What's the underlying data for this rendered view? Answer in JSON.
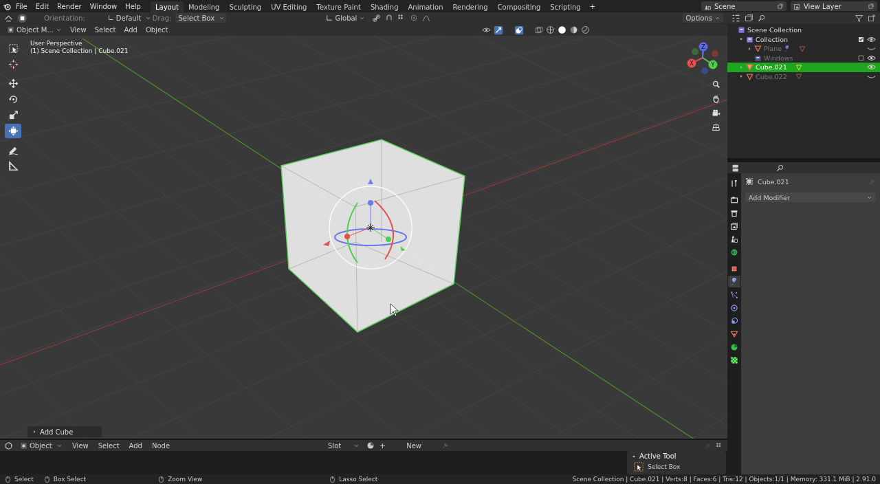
{
  "top_bar": {
    "menus": [
      "File",
      "Edit",
      "Render",
      "Window",
      "Help"
    ],
    "workspaces": [
      {
        "label": "Layout",
        "selected": true
      },
      {
        "label": "Modeling",
        "selected": false
      },
      {
        "label": "Sculpting",
        "selected": false
      },
      {
        "label": "UV Editing",
        "selected": false
      },
      {
        "label": "Texture Paint",
        "selected": false
      },
      {
        "label": "Shading",
        "selected": false
      },
      {
        "label": "Animation",
        "selected": false
      },
      {
        "label": "Rendering",
        "selected": false
      },
      {
        "label": "Compositing",
        "selected": false
      },
      {
        "label": "Scripting",
        "selected": false
      }
    ],
    "add_workspace": "+",
    "scene": "Scene",
    "view_layer": "View Layer"
  },
  "tool_header": {
    "orientation_label": "Orientation:",
    "orientation": "Default",
    "drag_label": "Drag:",
    "drag": "Select Box",
    "transform": "Global",
    "options": "Options"
  },
  "viewport_header": {
    "mode": "Object M...",
    "menus": [
      "View",
      "Select",
      "Add",
      "Object"
    ]
  },
  "viewport": {
    "view_name": "User Perspective",
    "context": "(1) Scene Collection | Cube.021",
    "gizmo_axes": [
      "X",
      "Y",
      "Z"
    ],
    "tools": [
      {
        "kind": "select",
        "selected": false
      },
      {
        "kind": "cursor",
        "selected": false
      },
      {
        "kind": "move",
        "selected": false
      },
      {
        "kind": "rotate",
        "selected": false
      },
      {
        "kind": "scale",
        "selected": false
      },
      {
        "kind": "transform",
        "selected": true
      },
      {
        "kind": "annotate",
        "selected": false
      },
      {
        "kind": "measure",
        "selected": false
      }
    ],
    "last_operation": "Add Cube"
  },
  "bottom_editor": {
    "mode": "Object",
    "menus": [
      "View",
      "Select",
      "Add",
      "Node"
    ],
    "slot": "Slot",
    "new": "New",
    "panel_title": "Active Tool",
    "tool": "Select Box"
  },
  "outliner": {
    "items": [
      {
        "label": "Scene Collection",
        "kind": "scene",
        "selected": false,
        "children": [
          {
            "label": "Collection",
            "kind": "collection",
            "selected": false,
            "expanded": true,
            "included": true,
            "visible": true,
            "children": [
              {
                "label": "Plane",
                "kind": "mesh",
                "selected": false,
                "expanded": false,
                "modifier": true,
                "visible": false
              },
              {
                "label": "Windows",
                "kind": "collection",
                "selected": false,
                "included": false,
                "visible": true
              }
            ]
          },
          {
            "label": "Cube.021",
            "kind": "mesh",
            "selected": true,
            "expanded": false,
            "modifier": false,
            "visible": true
          },
          {
            "label": "Cube.022",
            "kind": "mesh",
            "selected": false,
            "expanded": false,
            "modifier": false,
            "visible": false
          }
        ]
      }
    ]
  },
  "properties": {
    "tabs": [
      {
        "kind": "tool",
        "selected": false
      },
      {
        "kind": "render",
        "selected": false
      },
      {
        "kind": "output",
        "selected": false
      },
      {
        "kind": "view_layer",
        "selected": false
      },
      {
        "kind": "scene",
        "selected": false
      },
      {
        "kind": "world",
        "selected": false
      },
      {
        "kind": "object",
        "selected": false
      },
      {
        "kind": "modifiers",
        "selected": true
      },
      {
        "kind": "particles",
        "selected": false
      },
      {
        "kind": "physics",
        "selected": false
      },
      {
        "kind": "constraints",
        "selected": false
      },
      {
        "kind": "data",
        "selected": false
      },
      {
        "kind": "material",
        "selected": false
      },
      {
        "kind": "texture",
        "selected": false
      }
    ],
    "object_name": "Cube.021",
    "add_modifier": "Add Modifier"
  },
  "status_bar": {
    "hints": [
      {
        "label": "Select"
      },
      {
        "label": "Box Select"
      },
      {
        "label": "Zoom View"
      },
      {
        "label": "Lasso Select"
      }
    ],
    "stats": "Scene Collection | Cube.021 | Verts:8 | Faces:6 | Tris:12 | Objects:1/1 | Memory: 331.1 MiB | 2.91.0"
  }
}
